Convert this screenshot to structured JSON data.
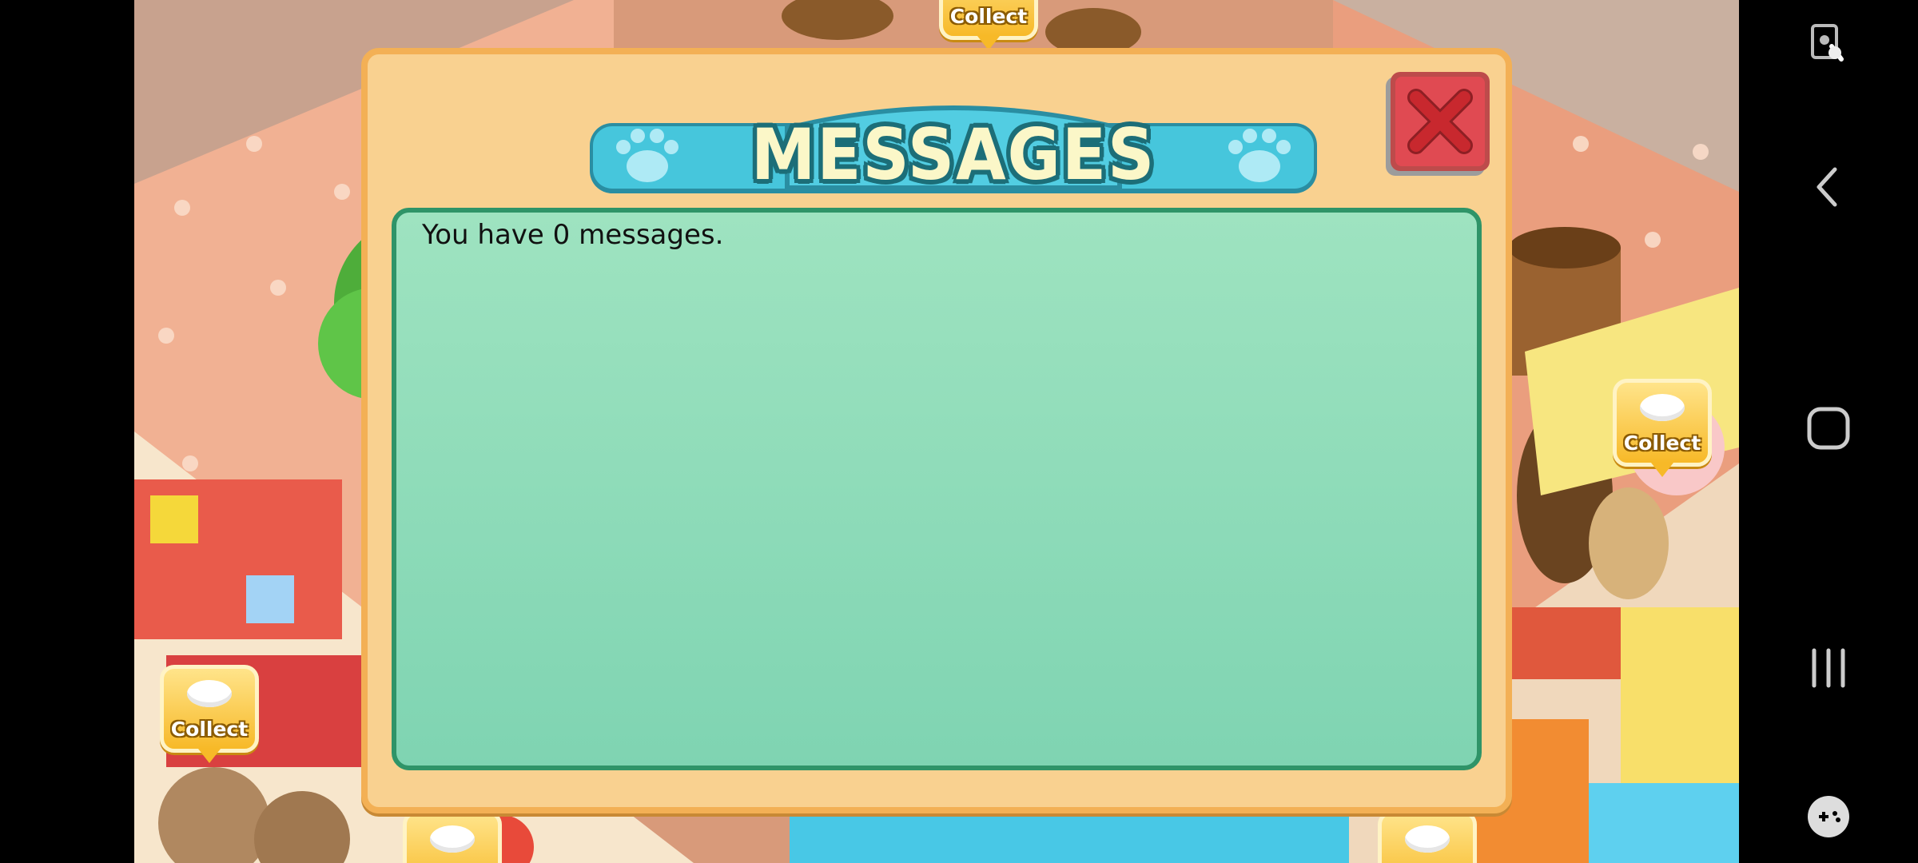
{
  "dialog": {
    "title": "MESSAGES",
    "message_text": "You have 0 messages."
  },
  "game": {
    "collect_label": "Collect"
  },
  "nav_bar": {
    "icons": [
      "screen-lock-icon",
      "back-icon",
      "home-icon",
      "recents-icon",
      "game-controller-icon"
    ]
  },
  "colors": {
    "dialog_bg": "#f9d190",
    "dialog_border": "#f3b055",
    "banner": "#46c6dc",
    "panel": "#8fdcb9",
    "panel_border": "#2f9468",
    "close": "#e04a52"
  }
}
